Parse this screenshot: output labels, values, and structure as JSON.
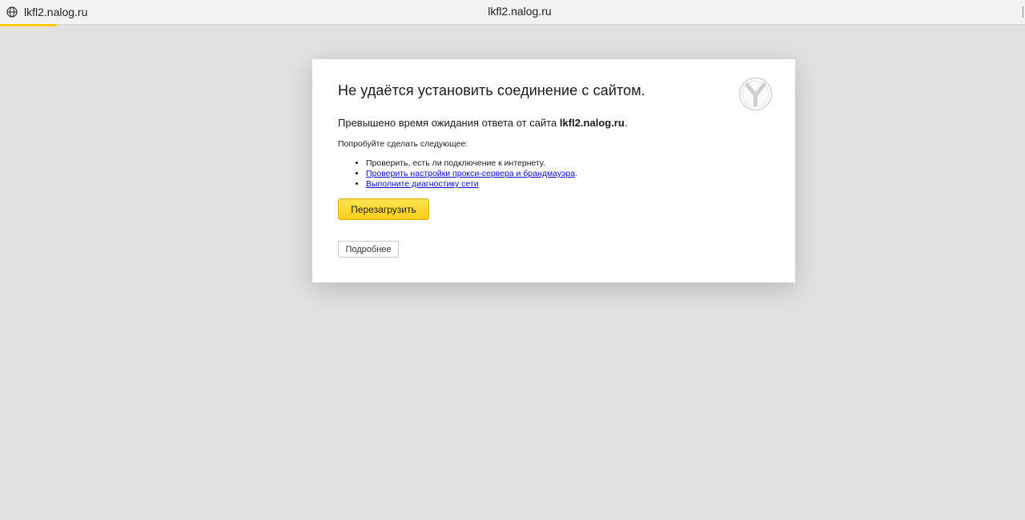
{
  "browser": {
    "tab_site": "lkfl2.nalog.ru",
    "center_url": "lkfl2.nalog.ru",
    "accent_color": "#ffcc00"
  },
  "error": {
    "title": "Не удаётся установить соединение с сайтом.",
    "subtitle_prefix": "Превышено время ожидания ответа от сайта ",
    "subtitle_host": "lkfl2.nalog.ru",
    "subtitle_suffix": ".",
    "try_label": "Попробуйте сделать следующее:",
    "tips": [
      {
        "text": "Проверить, есть ли подключение к интернету.",
        "link": false
      },
      {
        "text": "Проверить настройки прокси-сервера и брандмауэра",
        "link": true,
        "suffix": "."
      },
      {
        "text": "Выполните диагностику сети",
        "link": true,
        "suffix": ""
      }
    ],
    "reload_label": "Перезагрузить",
    "details_label": "Подробнее",
    "logo_icon": "yandex-browser-logo-icon"
  }
}
